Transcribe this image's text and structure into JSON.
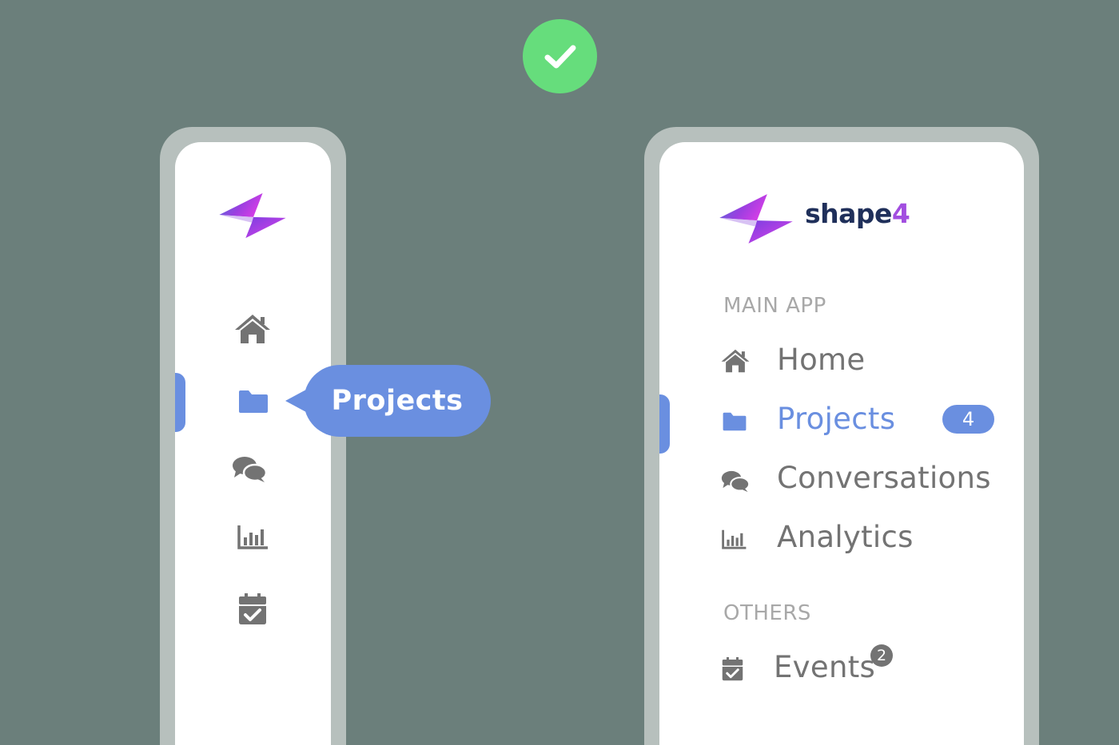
{
  "status": {
    "icon": "check-icon",
    "color": "#66dd7c"
  },
  "colors": {
    "background": "#6b7f7b",
    "accent": "#6a8fe0",
    "text": "#737373",
    "brand": "#1f2f5a",
    "brand_accent": "#a24ee0"
  },
  "collapsed_sidebar": {
    "logo_icon": "bolt-logo-icon",
    "items": [
      {
        "icon": "home-icon"
      },
      {
        "icon": "folder-icon",
        "active": true
      },
      {
        "icon": "chat-icon"
      },
      {
        "icon": "bar-chart-icon"
      },
      {
        "icon": "calendar-check-icon"
      }
    ],
    "tooltip": "Projects"
  },
  "expanded_sidebar": {
    "brand": {
      "name": "shape",
      "suffix": "4"
    },
    "sections": [
      {
        "label": "MAIN APP",
        "items": [
          {
            "label": "Home",
            "icon": "home-icon"
          },
          {
            "label": "Projects",
            "icon": "folder-icon",
            "active": true,
            "badge": "4"
          },
          {
            "label": "Conversations",
            "icon": "chat-icon"
          },
          {
            "label": "Analytics",
            "icon": "bar-chart-icon"
          }
        ]
      },
      {
        "label": "OTHERS",
        "items": [
          {
            "label": "Events",
            "icon": "calendar-check-icon",
            "badge": "2"
          }
        ]
      }
    ]
  }
}
